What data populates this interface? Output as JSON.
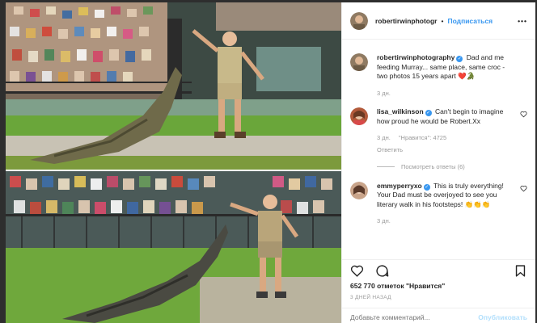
{
  "post": {
    "username": "robertirwinphotography",
    "username_short": "robertirwinphotogr",
    "follow_label": "Подписаться",
    "more_label": "•••"
  },
  "caption": {
    "username": "robertirwinphotography",
    "text": "Dad and me feeding Murray... same place, same croc - two photos 15 years apart ❤️🐊",
    "age": "3 дн."
  },
  "comments": [
    {
      "username": "lisa_wilkinson",
      "text": "Can't begin to imagine how proud he would be Robert.Xx",
      "age": "3 дн.",
      "likes": "\"Нравится\": 4725",
      "reply": "Ответить",
      "thread": "Посмотреть ответы (6)"
    },
    {
      "username": "emmyperryxo",
      "text": "This is truly everything! Your Dad must be overjoyed to see you literary walk in his footsteps! 👏👏👏",
      "age": "3 дн."
    }
  ],
  "likes_count": "652 770 отметок \"Нравится\"",
  "posted_when": "3 ДНЕЙ НАЗАД",
  "add_comment_placeholder": "Добавьте комментарий...",
  "publish_label": "Опубликовать",
  "colors": {
    "accent": "#3897f0",
    "muted": "#999999",
    "publish_disabled": "#b2dffc"
  }
}
